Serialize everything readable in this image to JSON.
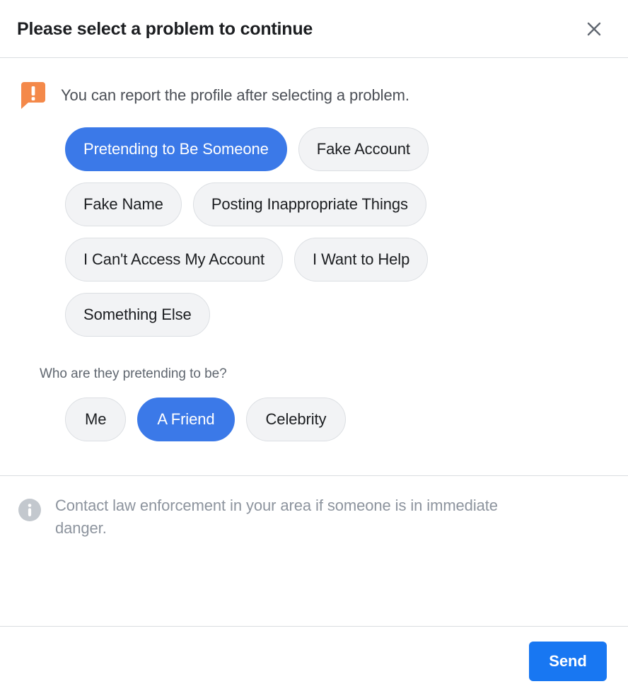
{
  "dialog": {
    "title": "Please select a problem to continue",
    "close_icon": "close-icon"
  },
  "notice": {
    "icon": "warning-speech-bubble-icon",
    "text": "You can report the profile after selecting a problem.",
    "icon_color": "#F4894A"
  },
  "problems": {
    "options": [
      {
        "label": "Pretending to Be Someone",
        "selected": true
      },
      {
        "label": "Fake Account",
        "selected": false
      },
      {
        "label": "Fake Name",
        "selected": false
      },
      {
        "label": "Posting Inappropriate Things",
        "selected": false
      },
      {
        "label": "I Can't Access My Account",
        "selected": false
      },
      {
        "label": "I Want to Help",
        "selected": false
      },
      {
        "label": "Something Else",
        "selected": false
      }
    ],
    "selected_color": "#3B79E8",
    "unselected_color": "#F2F3F5"
  },
  "subquestion": {
    "label": "Who are they pretending to be?",
    "options": [
      {
        "label": "Me",
        "selected": false
      },
      {
        "label": "A Friend",
        "selected": true
      },
      {
        "label": "Celebrity",
        "selected": false
      }
    ]
  },
  "info": {
    "icon": "info-circle-icon",
    "text": "Contact law enforcement in your area if someone is in immediate danger.",
    "icon_color": "#C3C8CE"
  },
  "actions": {
    "send_label": "Send",
    "send_color": "#1877F2"
  }
}
